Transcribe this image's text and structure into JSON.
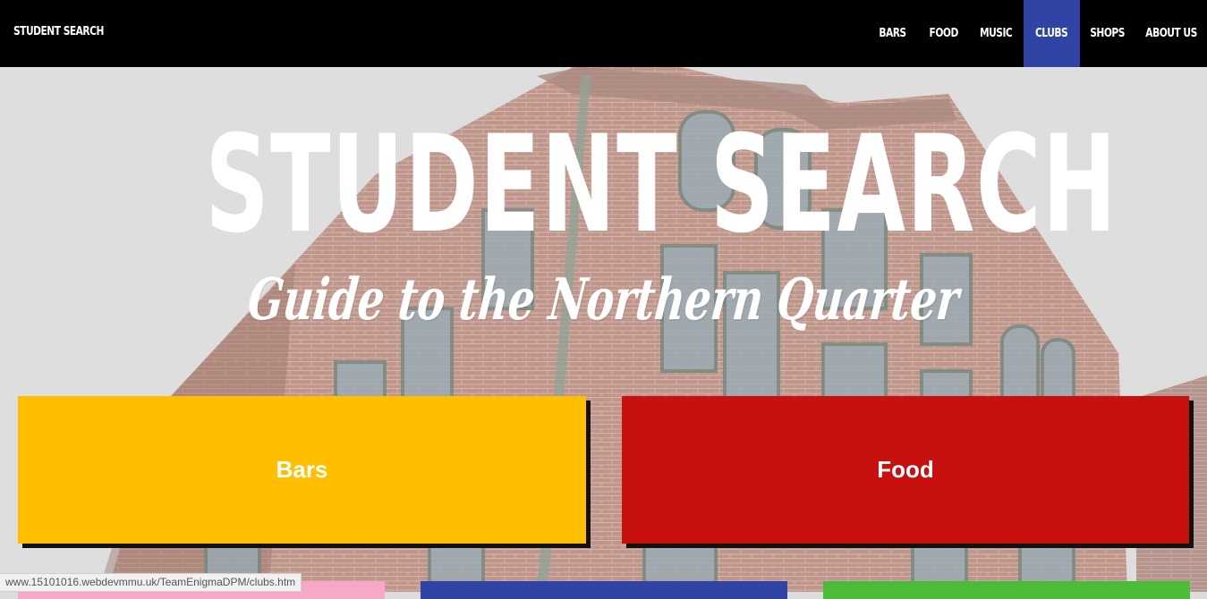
{
  "nav": {
    "brand": "STUDENT SEARCH",
    "items": [
      {
        "label": "BARS",
        "active": false
      },
      {
        "label": "FOOD",
        "active": false
      },
      {
        "label": "MUSIC",
        "active": false
      },
      {
        "label": "CLUBS",
        "active": true
      },
      {
        "label": "SHOPS",
        "active": false
      },
      {
        "label": "ABOUT US",
        "active": false
      }
    ],
    "active_color": "#2f44a4"
  },
  "hero": {
    "title": "STUDENT SEARCH",
    "subtitle": "Guide to the Northern Quarter"
  },
  "tiles": [
    {
      "label": "Bars",
      "color": "#ffbf00"
    },
    {
      "label": "Food",
      "color": "#c8100f"
    },
    {
      "label": "",
      "color": "#f7a8c8"
    },
    {
      "label": "",
      "color": "#2f44a4"
    },
    {
      "label": "",
      "color": "#4cbb3a"
    }
  ],
  "status_bar": {
    "url": "www.15101016.webdevmmu.uk/TeamEnigmaDPM/clubs.htm"
  }
}
